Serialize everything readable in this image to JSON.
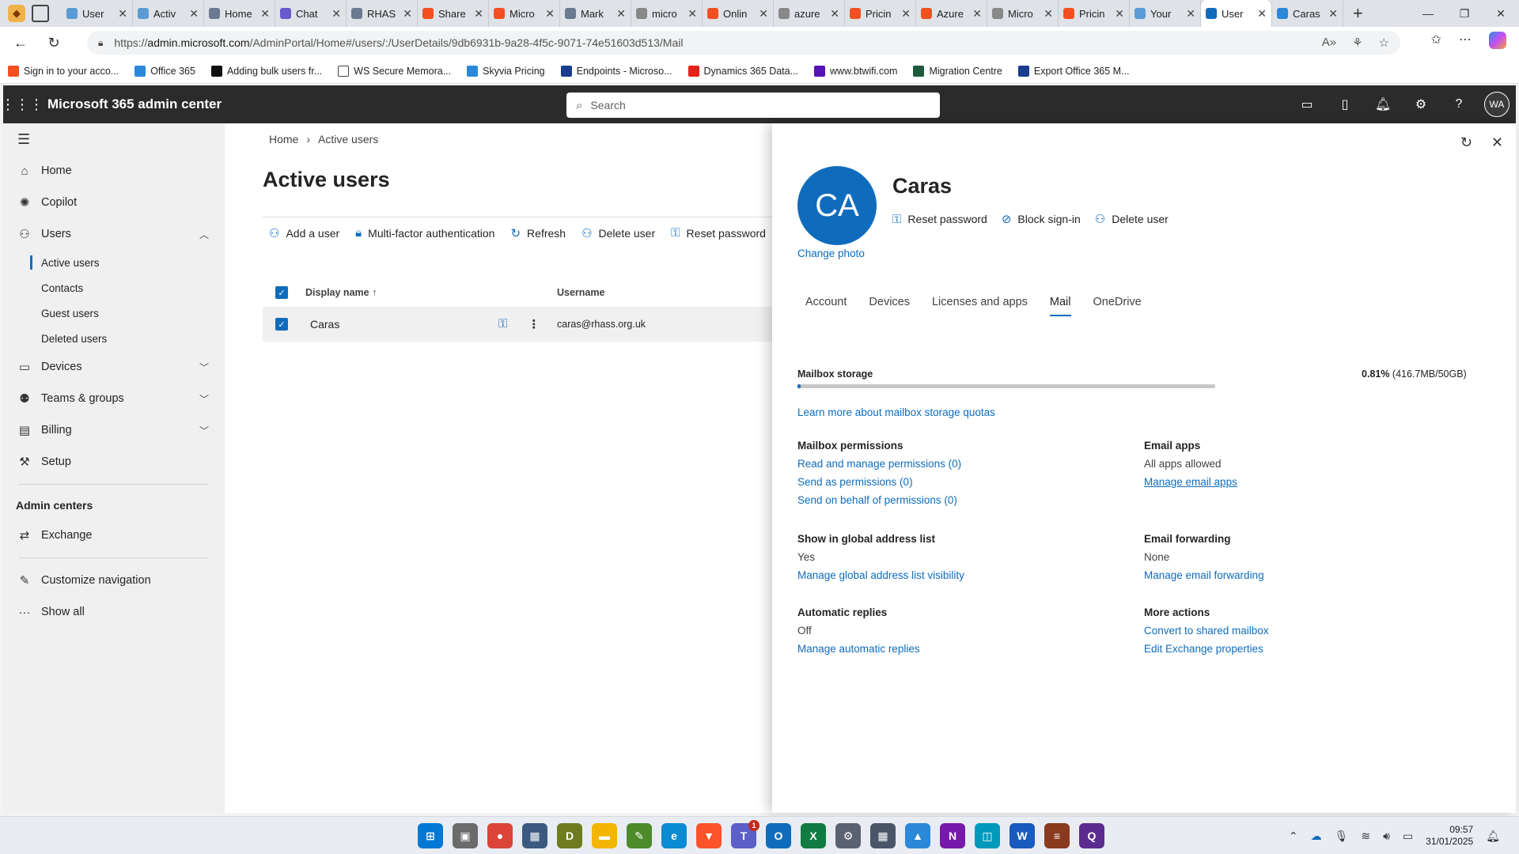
{
  "browser": {
    "tabs": [
      {
        "label": "User",
        "color": "#5b9bd5"
      },
      {
        "label": "Activ",
        "color": "#5b9bd5"
      },
      {
        "label": "Home",
        "color": "#6b7a90"
      },
      {
        "label": "Chat",
        "color": "#6a5acd"
      },
      {
        "label": "RHAS",
        "color": "#6b7a90"
      },
      {
        "label": "Share",
        "color": "#f25022"
      },
      {
        "label": "Micro",
        "color": "#f25022"
      },
      {
        "label": "Mark",
        "color": "#6b7a90"
      },
      {
        "label": "micro",
        "color": "#888888"
      },
      {
        "label": "Onlin",
        "color": "#f25022"
      },
      {
        "label": "azure",
        "color": "#888888"
      },
      {
        "label": "Pricin",
        "color": "#f25022"
      },
      {
        "label": "Azure",
        "color": "#f25022"
      },
      {
        "label": "Micro",
        "color": "#888888"
      },
      {
        "label": "Pricin",
        "color": "#f25022"
      },
      {
        "label": "Your",
        "color": "#5b9bd5"
      },
      {
        "label": "User",
        "color": "#0f6cbd"
      },
      {
        "label": "Caras",
        "color": "#2b88d8"
      }
    ],
    "url_prefix": "https://",
    "url_host": "admin.microsoft.com",
    "url_path": "/AdminPortal/Home#/users/:/UserDetails/9db6931b-9a28-4f5c-9071-74e51603d513/Mail",
    "bookmarks": [
      {
        "label": "Sign in to your acco...",
        "color": "#f25022"
      },
      {
        "label": "Office 365",
        "color": "#2b88d8"
      },
      {
        "label": "Adding bulk users fr...",
        "color": "#111111"
      },
      {
        "label": "WS Secure Memora...",
        "color": "#ffffff"
      },
      {
        "label": "Skyvia Pricing",
        "color": "#2b88d8"
      },
      {
        "label": "Endpoints - Microso...",
        "color": "#1a3d8f"
      },
      {
        "label": "Dynamics 365 Data...",
        "color": "#e62117"
      },
      {
        "label": "www.btwifi.com",
        "color": "#5514b4"
      },
      {
        "label": "Migration Centre",
        "color": "#1e5a3c"
      },
      {
        "label": "Export Office 365 M...",
        "color": "#1a3d8f"
      }
    ]
  },
  "header": {
    "app_title": "Microsoft 365 admin center",
    "search_placeholder": "Search",
    "avatar_initials": "WA"
  },
  "leftnav": {
    "items": [
      {
        "label": "Home",
        "icon": "home-icon",
        "glyph": "⌂"
      },
      {
        "label": "Copilot",
        "icon": "copilot-icon",
        "glyph": "✺"
      },
      {
        "label": "Users",
        "icon": "user-icon",
        "glyph": "⚇"
      }
    ],
    "users_sub": [
      "Active users",
      "Contacts",
      "Guest users",
      "Deleted users"
    ],
    "items2": [
      {
        "label": "Devices",
        "icon": "laptop-icon",
        "glyph": "▭"
      },
      {
        "label": "Teams & groups",
        "icon": "people-icon",
        "glyph": "⚉"
      },
      {
        "label": "Billing",
        "icon": "card-icon",
        "glyph": "▤"
      },
      {
        "label": "Setup",
        "icon": "wrench-icon",
        "glyph": "⚒"
      }
    ],
    "admin_centers_heading": "Admin centers",
    "exchange": "Exchange",
    "customize": "Customize navigation",
    "show_all": "Show all"
  },
  "main": {
    "breadcrumb_home": "Home",
    "breadcrumb_current": "Active users",
    "title": "Active users",
    "commands": {
      "add_user": "Add a user",
      "mfa": "Multi-factor authentication",
      "refresh": "Refresh",
      "delete_user": "Delete user",
      "reset_password": "Reset password"
    },
    "columns": {
      "display_name": "Display name",
      "username": "Username"
    },
    "rows": [
      {
        "display_name": "Caras",
        "username": "caras@rhass.org.uk"
      }
    ]
  },
  "panel": {
    "initials": "CA",
    "name": "Caras",
    "change_photo": "Change photo",
    "actions": {
      "reset_password": "Reset password",
      "block_signin": "Block sign-in",
      "delete_user": "Delete user"
    },
    "tabs": [
      "Account",
      "Devices",
      "Licenses and apps",
      "Mail",
      "OneDrive"
    ],
    "active_tab": "Mail",
    "mailbox_storage_label": "Mailbox storage",
    "mailbox_storage_percent": 0.81,
    "mailbox_storage_pct_text": "0.81%",
    "mailbox_storage_detail": " (416.7MB/50GB)",
    "learn_more": "Learn more about mailbox storage quotas",
    "mailbox_permissions": {
      "heading": "Mailbox permissions",
      "read_manage": "Read and manage permissions (0)",
      "send_as": "Send as permissions (0)",
      "send_on_behalf": "Send on behalf of permissions (0)"
    },
    "email_apps": {
      "heading": "Email apps",
      "value": "All apps allowed",
      "link": "Manage email apps"
    },
    "gal": {
      "heading": "Show in global address list",
      "value": "Yes",
      "link": "Manage global address list visibility"
    },
    "forwarding": {
      "heading": "Email forwarding",
      "value": "None",
      "link": "Manage email forwarding"
    },
    "auto_replies": {
      "heading": "Automatic replies",
      "value": "Off",
      "link": "Manage automatic replies"
    },
    "more_actions": {
      "heading": "More actions",
      "convert": "Convert to shared mailbox",
      "edit_exchange": "Edit Exchange properties"
    }
  },
  "taskbar": {
    "apps": [
      {
        "name": "start-icon",
        "glyph": "⊞",
        "color": "#0078d4"
      },
      {
        "name": "task-view-icon",
        "glyph": "▣",
        "color": "#6b6b6b"
      },
      {
        "name": "chrome-icon",
        "glyph": "●",
        "color": "#db4437"
      },
      {
        "name": "remote-desktop-icon",
        "glyph": "▦",
        "color": "#3c5a80"
      },
      {
        "name": "dns-icon",
        "glyph": "D",
        "color": "#6e7b1f"
      },
      {
        "name": "file-explorer-icon",
        "glyph": "▬",
        "color": "#f2b600"
      },
      {
        "name": "notepad-icon",
        "glyph": "✎",
        "color": "#4d8a2a"
      },
      {
        "name": "edge-icon",
        "glyph": "e",
        "color": "#0c8ad4"
      },
      {
        "name": "brave-icon",
        "glyph": "▼",
        "color": "#fb542b"
      },
      {
        "name": "teams-icon",
        "glyph": "T",
        "color": "#5b5fc7",
        "badge": "1"
      },
      {
        "name": "outlook-icon",
        "glyph": "O",
        "color": "#0f6cbd"
      },
      {
        "name": "excel-icon",
        "glyph": "X",
        "color": "#107c41"
      },
      {
        "name": "settings-icon",
        "glyph": "⚙",
        "color": "#5a6270"
      },
      {
        "name": "calculator-icon",
        "glyph": "▦",
        "color": "#4a5568"
      },
      {
        "name": "photos-icon",
        "glyph": "▲",
        "color": "#2b88d8"
      },
      {
        "name": "onenote-icon",
        "glyph": "N",
        "color": "#7719aa"
      },
      {
        "name": "screen-sketch-icon",
        "glyph": "◫",
        "color": "#0099bc"
      },
      {
        "name": "word-icon",
        "glyph": "W",
        "color": "#185abd"
      },
      {
        "name": "winrar-icon",
        "glyph": "≡",
        "color": "#8a3a1e"
      },
      {
        "name": "app-q-icon",
        "glyph": "Q",
        "color": "#5b2c8f"
      }
    ],
    "time": "09:57",
    "date": "31/01/2025"
  }
}
